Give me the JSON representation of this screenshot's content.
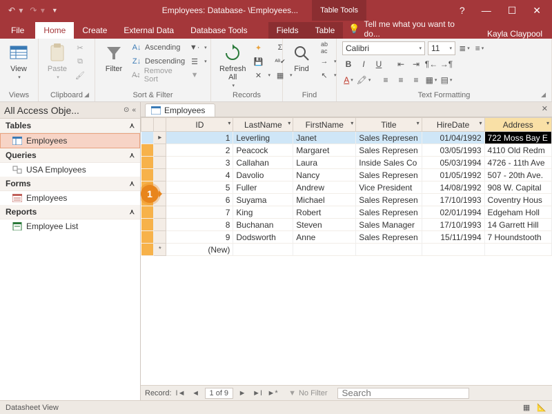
{
  "titlebar": {
    "app_title": "Employees: Database- \\Employees...",
    "table_tools": "Table Tools",
    "help": "?",
    "user": "Kayla Claypool"
  },
  "tabs": {
    "file": "File",
    "home": "Home",
    "create": "Create",
    "external": "External Data",
    "dbtools": "Database Tools",
    "fields": "Fields",
    "table": "Table",
    "tellme": "Tell me what you want to do..."
  },
  "ribbon": {
    "views": {
      "view": "View",
      "label": "Views"
    },
    "clipboard": {
      "paste": "Paste",
      "label": "Clipboard"
    },
    "sortfilter": {
      "filter": "Filter",
      "ascending": "Ascending",
      "descending": "Descending",
      "removesort": "Remove Sort",
      "label": "Sort & Filter"
    },
    "records": {
      "refresh": "Refresh\nAll",
      "label": "Records"
    },
    "find": {
      "find": "Find",
      "label": "Find"
    },
    "textfmt": {
      "font": "Calibri",
      "size": "11",
      "label": "Text Formatting"
    }
  },
  "nav": {
    "header": "All Access Obje...",
    "sections": {
      "tables": "Tables",
      "queries": "Queries",
      "forms": "Forms",
      "reports": "Reports"
    },
    "items": {
      "table_emp": "Employees",
      "query_usa": "USA Employees",
      "form_emp": "Employees",
      "report_list": "Employee List"
    }
  },
  "doc": {
    "tab": "Employees",
    "columns": [
      "ID",
      "LastName",
      "FirstName",
      "Title",
      "HireDate",
      "Address"
    ],
    "rows": [
      {
        "id": "1",
        "last": "Leverling",
        "first": "Janet",
        "title": "Sales Represen",
        "hire": "01/04/1992",
        "addr": "722 Moss Bay E"
      },
      {
        "id": "2",
        "last": "Peacock",
        "first": "Margaret",
        "title": "Sales Represen",
        "hire": "03/05/1993",
        "addr": "4110 Old Redm"
      },
      {
        "id": "3",
        "last": "Callahan",
        "first": "Laura",
        "title": "Inside Sales Co",
        "hire": "05/03/1994",
        "addr": "4726 - 11th Ave"
      },
      {
        "id": "4",
        "last": "Davolio",
        "first": "Nancy",
        "title": "Sales Represen",
        "hire": "01/05/1992",
        "addr": "507 - 20th Ave."
      },
      {
        "id": "5",
        "last": "Fuller",
        "first": "Andrew",
        "title": "Vice President",
        "hire": "14/08/1992",
        "addr": "908 W. Capital"
      },
      {
        "id": "6",
        "last": "Suyama",
        "first": "Michael",
        "title": "Sales Represen",
        "hire": "17/10/1993",
        "addr": "Coventry Hous"
      },
      {
        "id": "7",
        "last": "King",
        "first": "Robert",
        "title": "Sales Represen",
        "hire": "02/01/1994",
        "addr": "Edgeham Holl"
      },
      {
        "id": "8",
        "last": "Buchanan",
        "first": "Steven",
        "title": "Sales Manager",
        "hire": "17/10/1993",
        "addr": "14 Garrett Hill"
      },
      {
        "id": "9",
        "last": "Dodsworth",
        "first": "Anne",
        "title": "Sales Represen",
        "hire": "15/11/1994",
        "addr": "7 Houndstooth"
      }
    ],
    "newrow": "(New)",
    "recnav": {
      "label": "Record:",
      "pos": "1 of 9",
      "nofilter": "No Filter",
      "search": "Search"
    }
  },
  "callout": "1",
  "statusbar": {
    "mode": "Datasheet View"
  }
}
